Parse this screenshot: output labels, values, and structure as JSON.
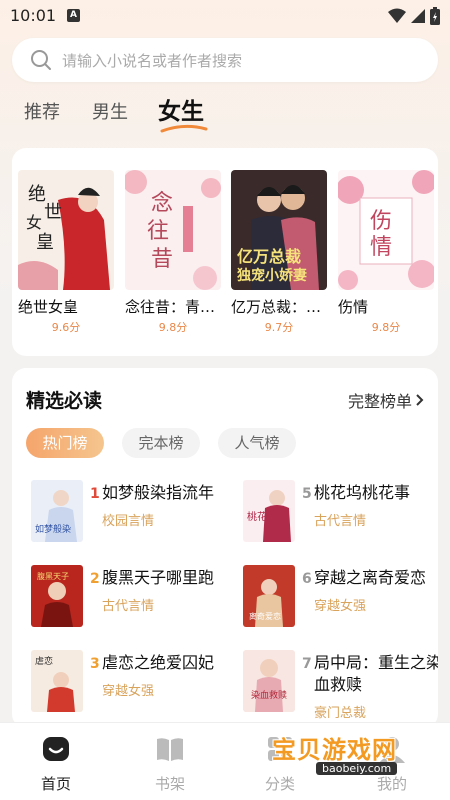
{
  "status": {
    "time": "10:01",
    "notif_icon": "A"
  },
  "search": {
    "placeholder": "请输入小说名或者作者搜索"
  },
  "tabs": [
    {
      "label": "推荐",
      "active": false
    },
    {
      "label": "男生",
      "active": false
    },
    {
      "label": "女生",
      "active": true
    }
  ],
  "featured": [
    {
      "title": "绝世女皇",
      "score": "9.6分"
    },
    {
      "title": "念往昔：青…",
      "score": "9.8分"
    },
    {
      "title": "亿万总裁：…",
      "score": "9.7分"
    },
    {
      "title": "伤情",
      "score": "9.8分"
    }
  ],
  "ranking": {
    "title": "精选必读",
    "more_label": "完整榜单",
    "chips": [
      "热门榜",
      "完本榜",
      "人气榜"
    ],
    "items": [
      {
        "rank": "1",
        "name": "如梦般染指流年",
        "genre": "校园言情"
      },
      {
        "rank": "2",
        "name": "腹黑天子哪里跑",
        "genre": "古代言情"
      },
      {
        "rank": "3",
        "name": "虐恋之绝爱囚妃",
        "genre": "穿越女强"
      },
      {
        "rank": "5",
        "name": "桃花坞桃花事",
        "genre": "古代言情"
      },
      {
        "rank": "6",
        "name": "穿越之离奇爱恋",
        "genre": "穿越女强"
      },
      {
        "rank": "7",
        "name": "局中局：重生之染血救赎",
        "genre": "豪门总裁"
      }
    ]
  },
  "nav": [
    {
      "label": "首页",
      "icon": "home-icon",
      "active": true
    },
    {
      "label": "书架",
      "icon": "book-icon",
      "active": false
    },
    {
      "label": "分类",
      "icon": "category-icon",
      "active": false
    },
    {
      "label": "我的",
      "icon": "profile-icon",
      "active": false
    }
  ],
  "watermark": {
    "text": "宝贝游戏网",
    "url": "baobeiy.com"
  },
  "colors": {
    "accent": "#e8884a",
    "genre": "#d9a35c",
    "rank_red": "#e04a3a",
    "rank_orange": "#f0a030",
    "rank_gray": "#999999"
  }
}
